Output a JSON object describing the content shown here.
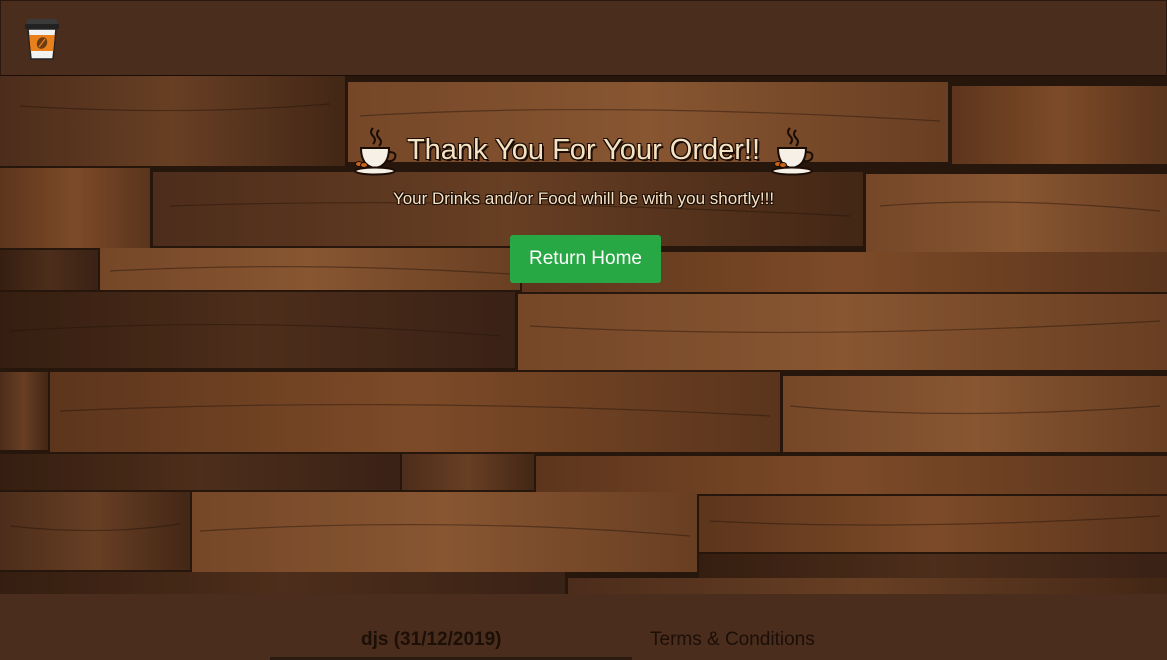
{
  "header": {
    "logo_icon": "coffee-cup-icon"
  },
  "hero": {
    "title": "Thank You For Your Order!!",
    "subtitle": "Your Drinks and/or Food whill be with you shortly!!!",
    "return_button_label": "Return Home",
    "title_icons": [
      "coffee-cup-icon",
      "coffee-cup-icon"
    ]
  },
  "footer": {
    "credit": "djs (31/12/2019)",
    "terms_link": "Terms & Conditions"
  },
  "colors": {
    "header_bg": "#4b2d1d",
    "button_bg": "#28a745",
    "title_text": "#f4e3c4"
  }
}
